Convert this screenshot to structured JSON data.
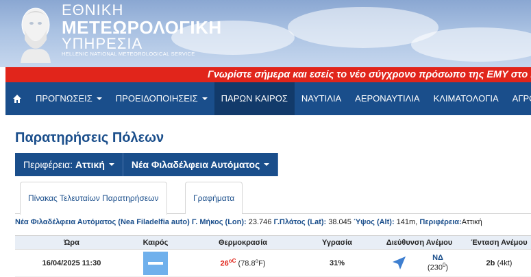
{
  "header": {
    "logo_line1": "ΕΘΝΙΚΗ",
    "logo_line2": "ΜΕΤΕΩΡΟΛΟΓΙΚΗ",
    "logo_line3": "ΥΠΗΡΕΣΙΑ",
    "logo_line4": "HELLENIC NATIONAL METEOROLOGICAL SERVICE"
  },
  "announcement": "Γνωρίστε σήμερα και εσείς το νέο σύγχρονο πρόσωπο της ΕΜΥ στο htt",
  "nav": {
    "items": [
      {
        "label": "ΠΡΟΓΝΩΣΕΙΣ"
      },
      {
        "label": "ΠΡΟΕΙΔΟΠΟΙΗΣΕΙΣ"
      },
      {
        "label": "ΠΑΡΩΝ ΚΑΙΡΟΣ"
      },
      {
        "label": "ΝΑΥΤΙΛΙΑ"
      },
      {
        "label": "ΑΕΡΟΝΑΥΤΙΛΙΑ"
      },
      {
        "label": "ΚΛΙΜΑΤΟΛΟΓΙΑ"
      },
      {
        "label": "ΑΓΡΟΤΙ"
      }
    ]
  },
  "page_title": "Παρατηρήσεις Πόλεων",
  "selectors": {
    "region_prefix": "Περιφέρεια:",
    "region_value": "Αττική",
    "station_value": "Νέα Φιλαδέλφεια Αυτόματος"
  },
  "tabs": [
    {
      "label": "Πίνακας Τελευταίων Παρατηρήσεων"
    },
    {
      "label": "Γραφήματα"
    }
  ],
  "station_info": {
    "name": "Νέα Φιλαδέλφεια Αυτόματος (Nea Filadelfia auto)",
    "lon_label": " Γ. Μήκος (Lon):",
    "lon_value": " 23.746",
    "lat_label": " Γ.Πλάτος (Lat):",
    "lat_value": " 38.045",
    "alt_label": " Ύψος (Alt):",
    "alt_value": " 141m,",
    "region_label": " Περιφέρεια:",
    "region_value": "Αττική"
  },
  "table": {
    "headers": [
      "Ώρα",
      "Καιρός",
      "Θερμοκρασία",
      "Υγρασία",
      "Διεύθυνση Ανέμου",
      "Ένταση Ανέμου"
    ],
    "row": {
      "time": "16/04/2025 11:30",
      "temp_c": "26",
      "temp_c_unit": "oC",
      "temp_f": " (78.8",
      "temp_f_unit": "o",
      "temp_f_end": "F)",
      "humidity": "31%",
      "wind_dir": "ΝΔ",
      "wind_deg": "(230",
      "wind_deg_unit": "0",
      "wind_deg_end": ")",
      "wind_bft": "2b",
      "wind_kt": " (4kt)"
    }
  },
  "colors": {
    "brand_blue": "#1a4e8b",
    "alert_red": "#e1251b",
    "humidity_green": "#2a8a2a"
  }
}
